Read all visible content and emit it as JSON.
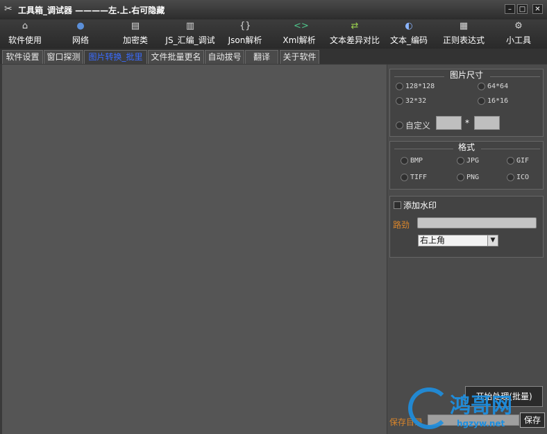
{
  "window": {
    "title": "工具箱_调试器 ————左.上.右可隐藏",
    "controls": [
      "–",
      "□",
      "✕"
    ]
  },
  "toolbar": [
    {
      "label": "软件使用",
      "icon": "camera-icon",
      "glyph": "⌂"
    },
    {
      "label": "网络",
      "icon": "globe-icon",
      "glyph": "●"
    },
    {
      "label": "加密类",
      "icon": "lock-icon",
      "glyph": "▤"
    },
    {
      "label": "JS_汇编_调试",
      "icon": "script-icon",
      "glyph": "▥"
    },
    {
      "label": "Json解析",
      "icon": "braces-icon",
      "glyph": "{}"
    },
    {
      "label": "Xml解析",
      "icon": "code-icon",
      "glyph": "<>"
    },
    {
      "label": "文本差异对比",
      "icon": "diff-icon",
      "glyph": "⇄"
    },
    {
      "label": "文本_编码",
      "icon": "encode-icon",
      "glyph": "◐"
    },
    {
      "label": "正则表达式",
      "icon": "document-icon",
      "glyph": "▦"
    },
    {
      "label": "小工具",
      "icon": "gear-icon",
      "glyph": "⚙"
    }
  ],
  "tabs": [
    {
      "label": "软件设置",
      "active": false
    },
    {
      "label": "窗口探测",
      "active": false
    },
    {
      "label": "图片转换_批里",
      "active": true
    },
    {
      "label": "文件批量更名",
      "active": false
    },
    {
      "label": "自动拔号",
      "active": false
    },
    {
      "label": "翻译",
      "active": false
    },
    {
      "label": "关于软件",
      "active": false
    }
  ],
  "size_group": {
    "title": "图片尺寸",
    "options": [
      "128*128",
      "64*64",
      "32*32",
      "16*16"
    ],
    "custom_label": "自定义",
    "custom_sep": "*",
    "custom_width": "",
    "custom_height": ""
  },
  "format_group": {
    "title": "格式",
    "options": [
      "BMP",
      "JPG",
      "GIF",
      "TIFF",
      "PNG",
      "ICO"
    ]
  },
  "watermark": {
    "checkbox_label": "添加水印",
    "path_label": "路劲",
    "path_value": "",
    "position_value": "右上角"
  },
  "actions": {
    "start_label": "开始处理(批量)",
    "save_path_label": "保存目录",
    "save_label": "保存"
  },
  "watermark_overlay": {
    "brand": "鸿哥网",
    "url": "hgzyw.net"
  },
  "colors": {
    "accent_blue": "#3a6cff",
    "orange_label": "#d9852b"
  }
}
